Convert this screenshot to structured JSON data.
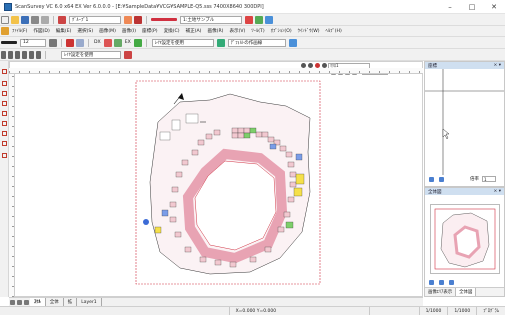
{
  "window": {
    "title": "ScanSurvey VC 6.0 x64 EX  Ver 6.0.0.0 - [E:¥SampleData¥VCG¥SAMPLE-Q5.sss 7400X8640 300DPI]",
    "minimize": "–",
    "maximize": "□",
    "close": "✕"
  },
  "toolbar1": {
    "layer_combo": "ｸﾞﾙｰﾌﾟ1",
    "sample_combo": "1:土地サンプル"
  },
  "menu": {
    "items": [
      "ﾌｧｲﾙ(F)",
      "作図(D)",
      "編集(E)",
      "選択(S)",
      "画像(M)",
      "画像(I)",
      "座標(P)",
      "変換(C)",
      "補正(A)",
      "画像(R)",
      "表示(V)",
      "ﾂｰﾙ(T)",
      "ｵﾌﾟｼｮﾝ(O)",
      "ｳｲﾝﾄﾞｳ(W)",
      "ﾍﾙﾌﾟ(H)"
    ]
  },
  "toolbar3": {
    "color_combo": "12",
    "layer_setting": "ﾚｲﾔ設定を使用",
    "default_option": "ﾃﾞﾌｫﾙﾄの作画線",
    "dx_label": "DX",
    "ex_label": "EX"
  },
  "toolbar4": {
    "layer_setting": "ﾚｲﾔ設定を使用"
  },
  "canvas": {
    "top_combo": "ﾏｸﾛ1",
    "zoom_combo": "ｽﾞｰﾑ"
  },
  "tabs": {
    "items": [
      "ｽｹﾙ",
      "全体",
      "拡",
      "Layer1"
    ],
    "active_index": 0
  },
  "panels": {
    "top_title": "座標",
    "bottom_title": "全体図",
    "scale_label": "倍率",
    "scale_value": "1",
    "bottom_tabs": [
      "画像ｴﾘｱ表示",
      "全体図"
    ]
  },
  "status": {
    "coords": "X=0.000  Y=0.000",
    "scale1": "1/1000",
    "scale2": "1/1000",
    "mode": "ﾌﾟﾛｸﾞﾗﾑ"
  },
  "colors": {
    "accent": "#2a6fb4",
    "parcel_pink": "#f2c8d0",
    "parcel_blue": "#7a9de8",
    "parcel_yellow": "#f5e04a",
    "parcel_green": "#7dcf6a",
    "boundary_red": "#d03040"
  }
}
